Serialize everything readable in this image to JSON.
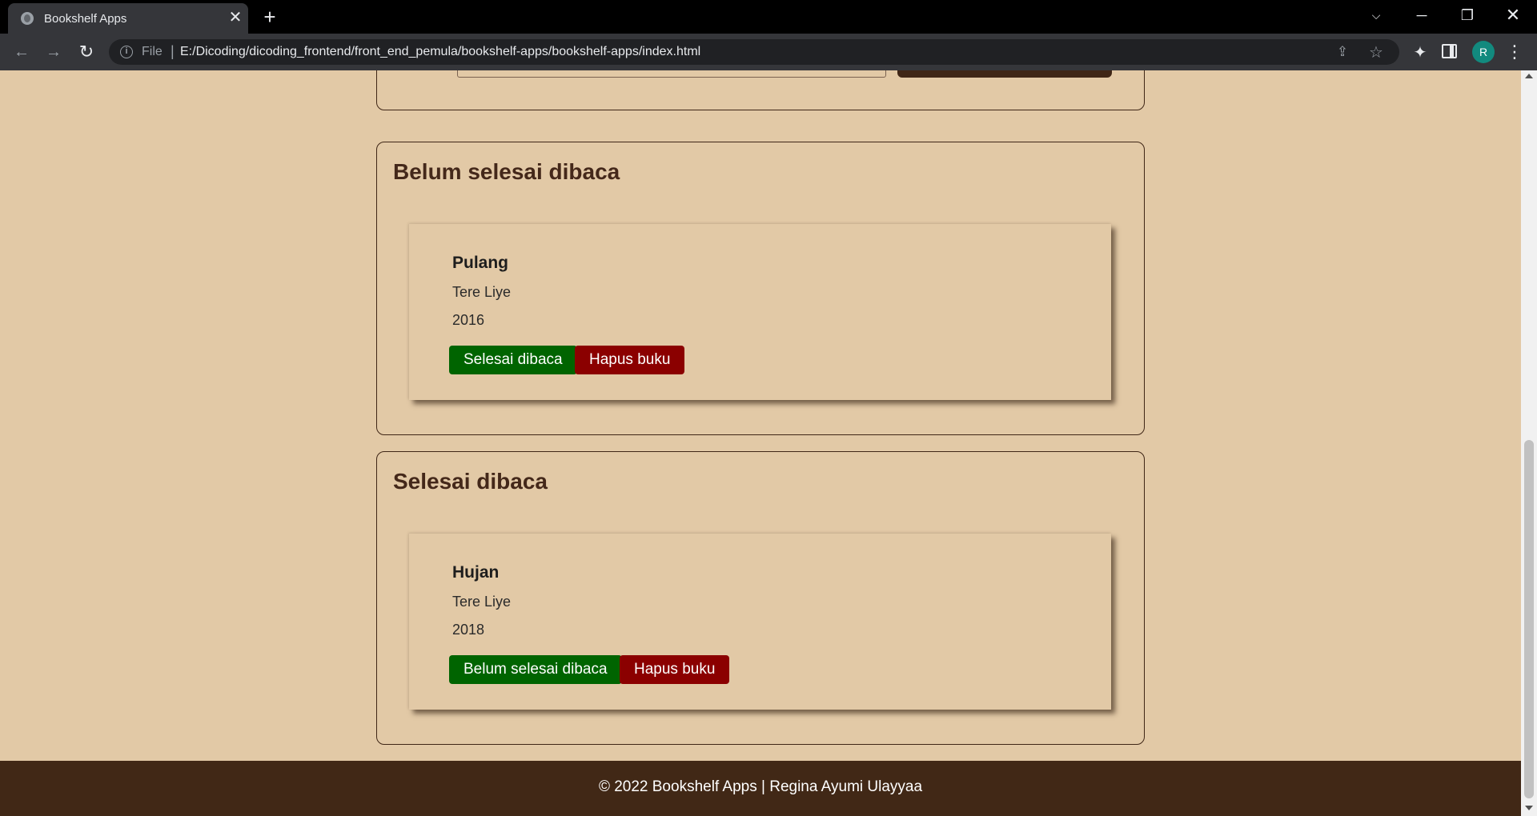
{
  "browser": {
    "tab_title": "Bookshelf Apps",
    "tab_close": "✕",
    "new_tab": "+",
    "scheme_label": "File",
    "url_separator": "|",
    "url": "E:/Dicoding/dicoding_frontend/front_end_pemula/bookshelf-apps/bookshelf-apps/index.html",
    "profile_initial": "R",
    "icons": [
      "globe-icon",
      "back-icon",
      "forward-icon",
      "reload-icon",
      "info-icon",
      "share-icon",
      "star-icon",
      "extensions-icon",
      "side-panel-icon",
      "menu-icon"
    ]
  },
  "shelves": {
    "incomplete": {
      "title": "Belum selesai dibaca",
      "books": [
        {
          "title": "Pulang",
          "author": "Tere Liye",
          "year": "2016",
          "toggle_label": "Selesai dibaca",
          "delete_label": "Hapus buku"
        }
      ]
    },
    "complete": {
      "title": "Selesai dibaca",
      "books": [
        {
          "title": "Hujan",
          "author": "Tere Liye",
          "year": "2018",
          "toggle_label": "Belum selesai dibaca",
          "delete_label": "Hapus buku"
        }
      ]
    }
  },
  "footer": {
    "text": "© 2022 Bookshelf Apps | Regina Ayumi Ulayyaa"
  },
  "colors": {
    "page_background": "#e2c9a6",
    "panel_border": "#3f2616",
    "heading": "#44281a",
    "footer_background": "#412816",
    "button_green": "#006400",
    "button_red": "#8b0000"
  }
}
